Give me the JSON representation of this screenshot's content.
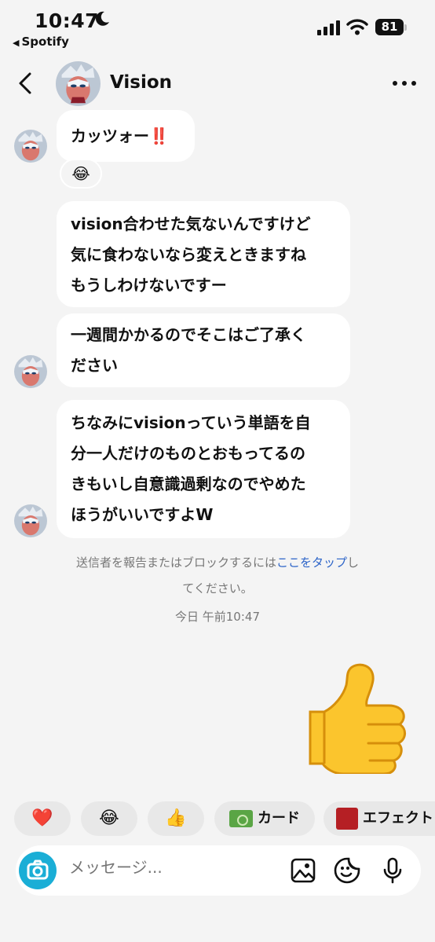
{
  "status_bar": {
    "time": "10:47",
    "back_app": "Spotify",
    "battery": "81"
  },
  "header": {
    "name": "Vision"
  },
  "messages": [
    {
      "lines": [
        "カッツォー"
      ],
      "suffix": "‼️",
      "reaction": "😂"
    },
    {
      "lines": [
        "vision合わせた気ないんですけど",
        "気に食わないなら変えときますね",
        "もうしわけないですー"
      ]
    },
    {
      "lines": [
        "一週間かかるのでそこはご了承く",
        "ださい"
      ]
    },
    {
      "lines": [
        "ちなみにvisionっていう単語を自",
        "分一人だけのものとおもってるの",
        "きもいし自意識過剰なのでやめた",
        "ほうがいいですよW"
      ]
    }
  ],
  "system_note": {
    "before": "送信者を報告またはブロックするには",
    "link": "ここをタップ",
    "after_line1": "し",
    "line2": "てください。"
  },
  "timestamp": "今日 午前10:47",
  "big_emoji": "thumbs-up",
  "quick_reactions": [
    {
      "icon": "❤️"
    },
    {
      "icon": "😂"
    },
    {
      "icon": "👍"
    },
    {
      "label": "カード"
    },
    {
      "label": "エフェクト"
    }
  ],
  "composer": {
    "placeholder": "メッセージ..."
  },
  "colors": {
    "background": "#f4f4f4",
    "bubble": "#ffffff",
    "link": "#2c64c8",
    "camera": "#1aaed6"
  }
}
